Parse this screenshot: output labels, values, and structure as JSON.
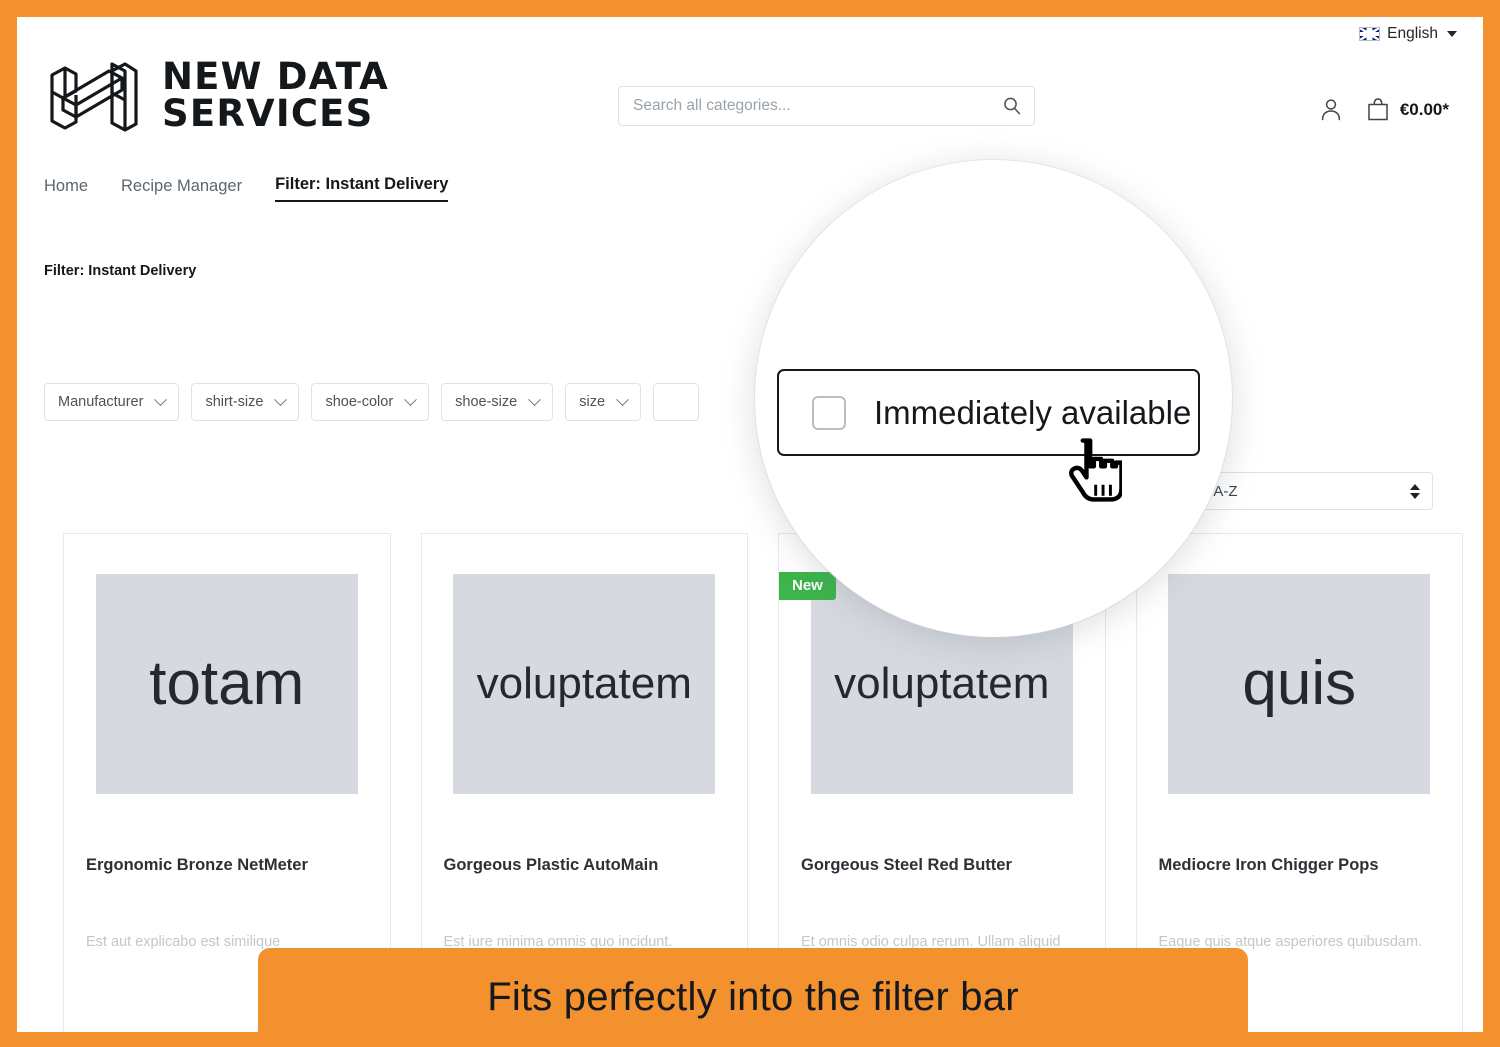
{
  "theme": {
    "frame_color": "#F3912F",
    "accent_green": "#3CB54A",
    "text_dark": "#14181B",
    "text_muted": "#5C6670",
    "placeholder_grey": "#C2C7CD",
    "image_placeholder_grey": "#D6DAE0"
  },
  "utility_bar": {
    "flag_icon": "uk-flag-icon",
    "language": "English",
    "caret_icon": "chevron-down-icon"
  },
  "brand": {
    "logo_icon": "isometric-h-logo",
    "line1": "NEW DATA",
    "line2": "SERVICES"
  },
  "search": {
    "placeholder": "Search all categories...",
    "value": "",
    "icon": "search-icon"
  },
  "account": {
    "user_icon": "user-account-icon",
    "cart_icon": "shopping-bag-icon",
    "cart_total": "€0.00*"
  },
  "nav": {
    "items": [
      {
        "label": "Home",
        "active": false
      },
      {
        "label": "Recipe Manager",
        "active": false
      },
      {
        "label": "Filter: Instant Delivery",
        "active": true
      }
    ]
  },
  "page": {
    "heading": "Filter: Instant Delivery"
  },
  "filters": [
    {
      "label": "Manufacturer",
      "icon": "chevron-down-icon"
    },
    {
      "label": "shirt-size",
      "icon": "chevron-down-icon"
    },
    {
      "label": "shoe-color",
      "icon": "chevron-down-icon"
    },
    {
      "label": "shoe-size",
      "icon": "chevron-down-icon"
    },
    {
      "label": "size",
      "icon": "chevron-down-icon"
    }
  ],
  "sort": {
    "value": "Name A-Z",
    "icon": "sort-updown-icon"
  },
  "products": [
    {
      "image_text": "totam",
      "title": "Ergonomic Bronze NetMeter",
      "description": "Est aut explicabo est similique",
      "badge": ""
    },
    {
      "image_text": "voluptatem",
      "title": "Gorgeous Plastic AutoMain",
      "description": "Est iure minima omnis quo incidunt.",
      "badge": ""
    },
    {
      "image_text": "voluptatem",
      "title": "Gorgeous Steel Red Butter",
      "description": "Et omnis odio culpa rerum. Ullam aliquid",
      "badge": "New"
    },
    {
      "image_text": "quis",
      "title": "Mediocre Iron Chigger Pops",
      "description": "Eaque quis atque asperiores quibusdam.",
      "badge": ""
    }
  ],
  "magnifier": {
    "checkbox_label": "Immediately available",
    "checkbox_checked": false,
    "cursor_icon": "pointing-hand-cursor"
  },
  "caption": {
    "text": "Fits perfectly into the filter bar"
  }
}
